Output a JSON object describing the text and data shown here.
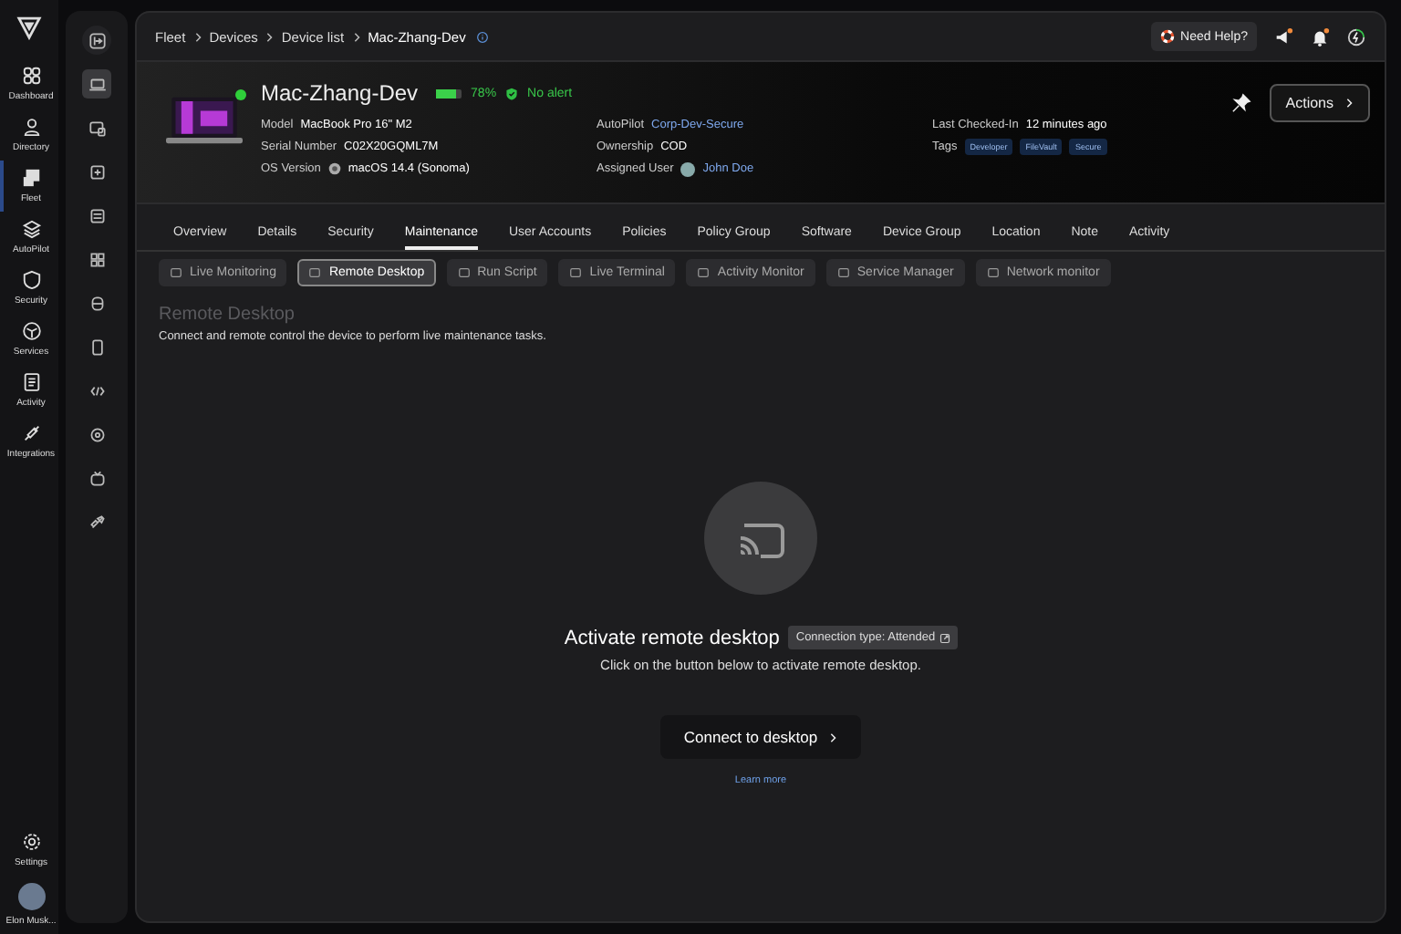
{
  "nav": {
    "items": [
      {
        "label": "Dashboard",
        "selected": false
      },
      {
        "label": "Directory",
        "selected": false
      },
      {
        "label": "Fleet",
        "selected": true
      },
      {
        "label": "AutoPilot",
        "selected": false
      },
      {
        "label": "Security",
        "selected": false
      },
      {
        "label": "Services",
        "selected": false
      },
      {
        "label": "Activity",
        "selected": false
      },
      {
        "label": "Integrations",
        "selected": false
      }
    ],
    "settings": "Settings",
    "user": "Elon Musk..."
  },
  "rail": [
    {
      "selected": true
    },
    {
      "selected": false
    },
    {
      "selected": false
    },
    {
      "selected": false
    },
    {
      "selected": false
    },
    {
      "selected": false
    },
    {
      "selected": false
    },
    {
      "selected": false
    },
    {
      "selected": false
    },
    {
      "selected": false
    },
    {
      "selected": false
    }
  ],
  "breadcrumb": [
    "Fleet",
    "Devices",
    "Device list",
    "Mac-Zhang-Dev"
  ],
  "help": "Need Help?",
  "device": {
    "name": "Mac-Zhang-Dev",
    "online": true,
    "battery": {
      "level": 0.78,
      "text": "78%"
    },
    "alert": "No alert",
    "fields": [
      [
        {
          "label": "Model",
          "value": "MacBook Pro 16\" M2",
          "kind": "text"
        },
        {
          "label": "Serial Number",
          "value": "C02X20GQML7M",
          "kind": "text"
        },
        {
          "label": "OS Version",
          "value": "macOS 14.4 (Sonoma)",
          "kind": "os"
        }
      ],
      [
        {
          "label": "AutoPilot",
          "value": "Corp-Dev-Secure",
          "kind": "link"
        },
        {
          "label": "Ownership",
          "value": "COD",
          "kind": "text"
        },
        {
          "label": "Assigned User",
          "value": "John Doe",
          "kind": "user"
        }
      ],
      [
        {
          "label": "Last Checked-In",
          "value": "12 minutes ago",
          "kind": "text"
        },
        {
          "label": "Tags",
          "tags": [
            "Developer",
            "FileVault",
            "Secure"
          ],
          "kind": "tags"
        }
      ]
    ],
    "actions": "Actions"
  },
  "tabs": [
    {
      "label": "Overview",
      "selected": false
    },
    {
      "label": "Details",
      "selected": false
    },
    {
      "label": "Security",
      "selected": false
    },
    {
      "label": "Maintenance",
      "selected": true
    },
    {
      "label": "User Accounts",
      "selected": false
    },
    {
      "label": "Policies",
      "selected": false
    },
    {
      "label": "Policy Group",
      "selected": false
    },
    {
      "label": "Software",
      "selected": false
    },
    {
      "label": "Device Group",
      "selected": false
    },
    {
      "label": "Location",
      "selected": false
    },
    {
      "label": "Note",
      "selected": false
    },
    {
      "label": "Activity",
      "selected": false
    }
  ],
  "tools": [
    {
      "label": "Live Monitoring",
      "selected": false
    },
    {
      "label": "Remote Desktop",
      "selected": true
    },
    {
      "label": "Run Script",
      "selected": false
    },
    {
      "label": "Live Terminal",
      "selected": false
    },
    {
      "label": "Activity Monitor",
      "selected": false
    },
    {
      "label": "Service Manager",
      "selected": false
    },
    {
      "label": "Network monitor",
      "selected": false
    }
  ],
  "section": {
    "title": "Remote Desktop",
    "description": "Connect and remote control the device to perform live maintenance tasks."
  },
  "empty": {
    "title": "Activate remote desktop",
    "badge": "Connection type: Attended",
    "subtitle": "Click on the button below to activate remote desktop.",
    "button": "Connect to desktop",
    "link": "Learn more"
  }
}
